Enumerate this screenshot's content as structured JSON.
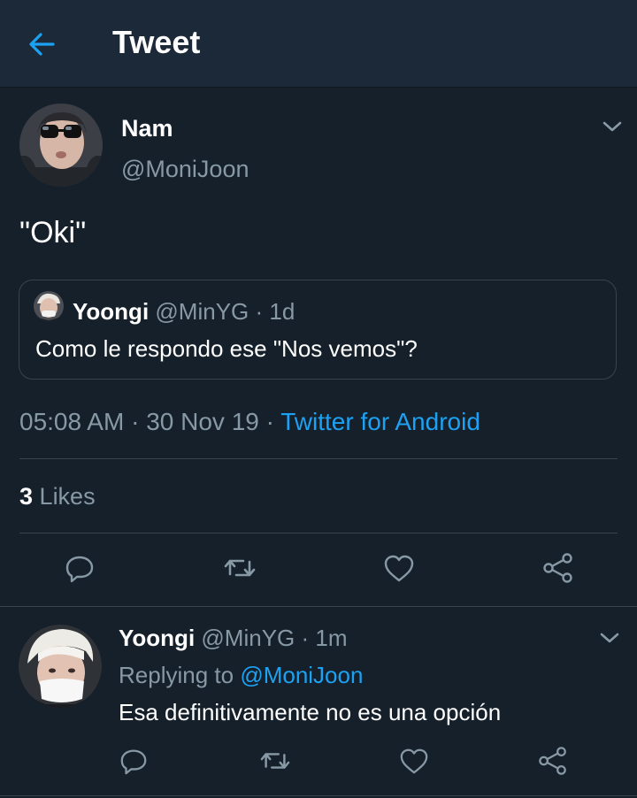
{
  "header": {
    "title": "Tweet",
    "back_icon": "arrow-left-icon"
  },
  "tweet": {
    "author_name": "Nam",
    "author_handle": "@MoniJoon",
    "text": "\"Oki\"",
    "quoted": {
      "name": "Yoongi",
      "handle": "@MinYG",
      "separator": "·",
      "time": "1d",
      "text": "Como le respondo ese \"Nos vemos\"?"
    },
    "time": "05:08 AM",
    "sep1": "·",
    "date": "30 Nov 19",
    "sep2": "·",
    "source": "Twitter for Android",
    "likes_count": "3",
    "likes_label": "Likes"
  },
  "reply": {
    "name": "Yoongi",
    "handle": "@MinYG",
    "separator": "·",
    "time": "1m",
    "replying_prefix": "Replying to",
    "replying_handle": "@MoniJoon",
    "text": "Esa definitivamente no es una opción"
  },
  "colors": {
    "background": "#15202b",
    "header_bg": "#1c2938",
    "accent": "#1da1f2",
    "muted": "#8899a6",
    "border": "#38444d"
  }
}
